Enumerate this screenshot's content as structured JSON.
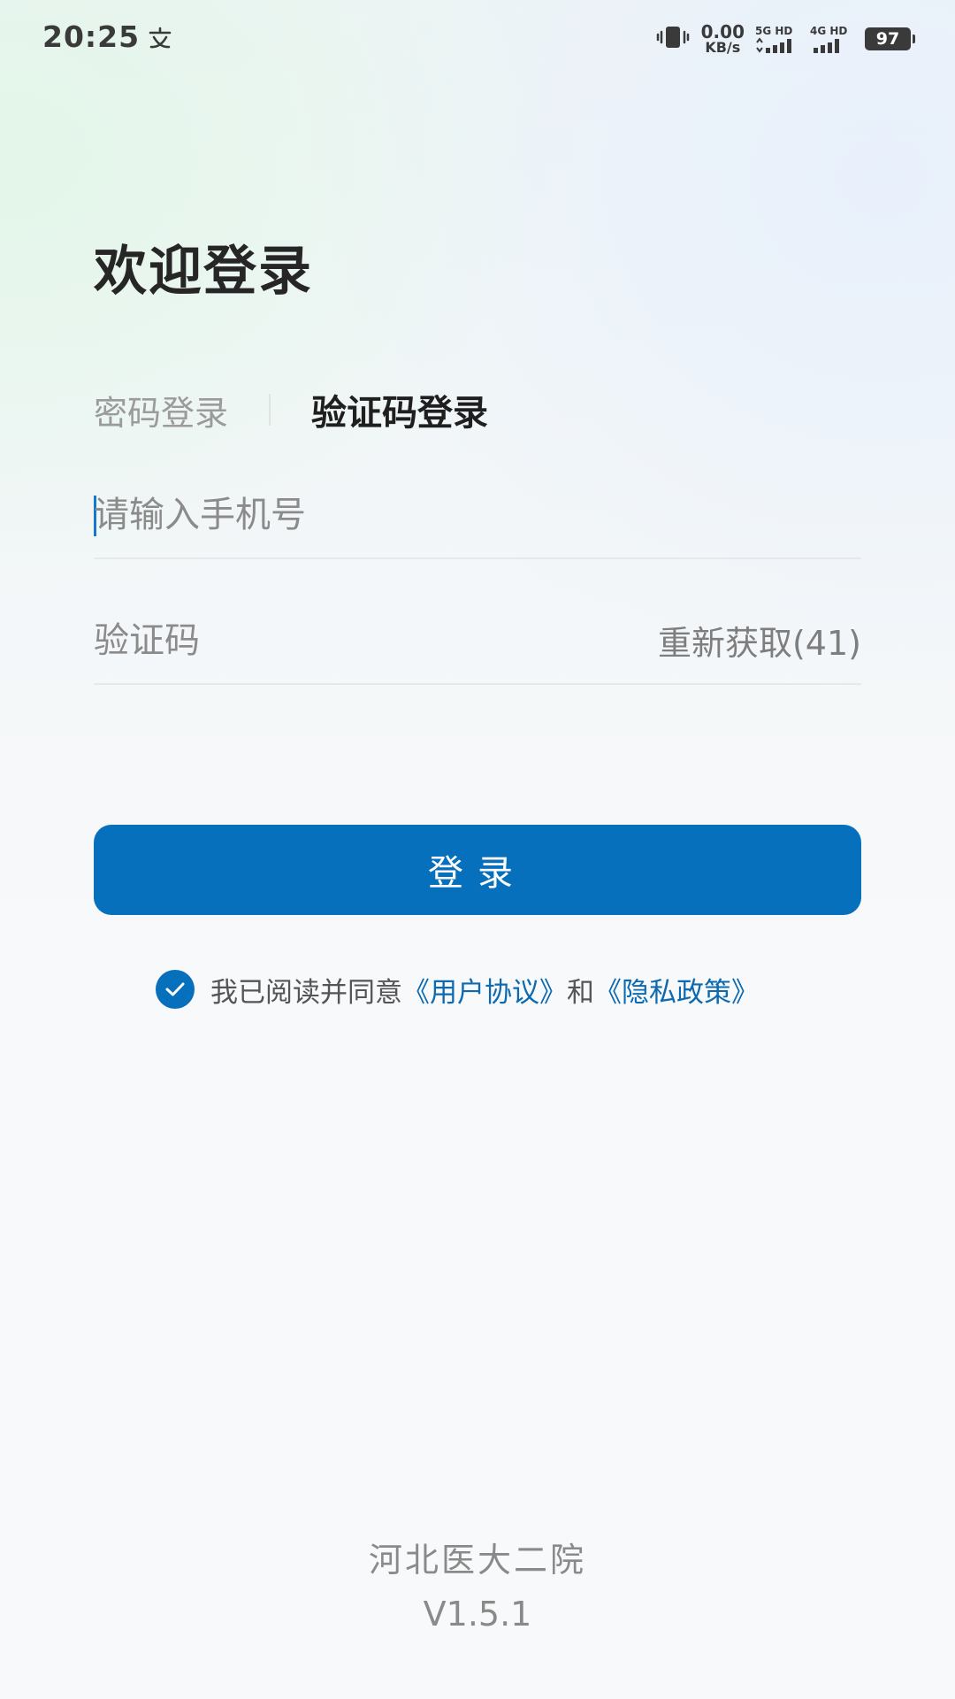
{
  "status_bar": {
    "time": "20:25",
    "net_speed_value": "0.00",
    "net_speed_unit": "KB/s",
    "sim1_label": "5G HD",
    "sim2_label": "4G HD",
    "battery": "97",
    "icons": [
      "app-notification-icon",
      "vibrate-icon",
      "signal-icon",
      "battery-icon"
    ]
  },
  "login": {
    "title": "欢迎登录",
    "tabs": [
      {
        "label": "密码登录",
        "active": false
      },
      {
        "label": "验证码登录",
        "active": true
      }
    ],
    "phone_placeholder": "请输入手机号",
    "code_placeholder": "验证码",
    "resend_label": "重新获取(41)",
    "submit_label": "登录"
  },
  "agreement": {
    "checked": true,
    "prefix": "我已阅读并同意",
    "user_agreement": "《用户协议》",
    "connector": "和",
    "privacy_policy": "《隐私政策》"
  },
  "footer": {
    "hospital_name": "河北医大二院",
    "version": "V1.5.1"
  },
  "colors": {
    "primary": "#0770bd",
    "link": "#0d6ab0",
    "muted": "#9b9b9b"
  }
}
